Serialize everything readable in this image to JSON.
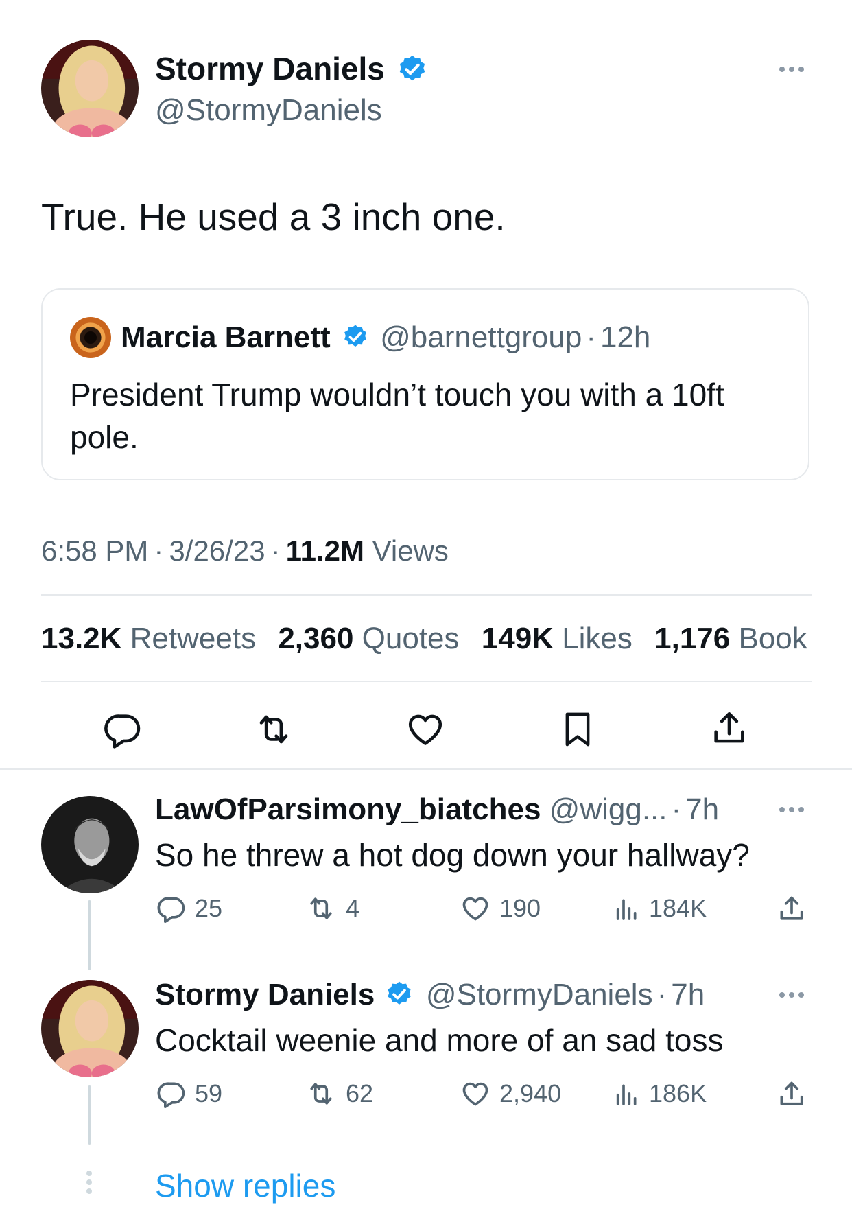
{
  "main_tweet": {
    "author_name": "Stormy Daniels",
    "author_handle": "@StormyDaniels",
    "text": "True. He used a 3 inch one.",
    "quoted": {
      "author_name": "Marcia Barnett",
      "author_handle": "@barnettgroup",
      "separator": "·",
      "time": "12h",
      "text": "President Trump wouldn’t touch you with a 10ft pole."
    },
    "time": "6:58 PM",
    "date": "3/26/23",
    "views_count": "11.2M",
    "views_label": "Views",
    "dot": "·",
    "stats": {
      "retweets": "13.2K",
      "retweets_label": "Retweets",
      "quotes": "2,360",
      "quotes_label": "Quotes",
      "likes": "149K",
      "likes_label": "Likes",
      "bookmarks": "1,176",
      "bookmarks_label": "Book"
    }
  },
  "replies": [
    {
      "author_name": "LawOfParsimony_biatches",
      "author_handle": "@wigg...",
      "separator": "·",
      "time": "7h",
      "text": "So he threw a hot dog down your hallway?",
      "reply_count": "25",
      "retweet_count": "4",
      "like_count": "190",
      "view_count": "184K"
    },
    {
      "author_name": "Stormy Daniels",
      "author_handle": "@StormyDaniels",
      "separator": "·",
      "time": "7h",
      "text": "Cocktail weenie and more of an sad toss",
      "reply_count": "59",
      "retweet_count": "62",
      "like_count": "2,940",
      "view_count": "186K"
    }
  ],
  "show_replies_label": "Show replies",
  "colors": {
    "accent": "#1d9bf0",
    "text": "#0f1419",
    "secondary": "#536471",
    "divider": "#e6e9ec"
  },
  "icons": [
    "verified-badge-icon",
    "more-icon",
    "reply-icon",
    "retweet-icon",
    "like-icon",
    "bookmark-icon",
    "share-icon",
    "views-icon"
  ]
}
